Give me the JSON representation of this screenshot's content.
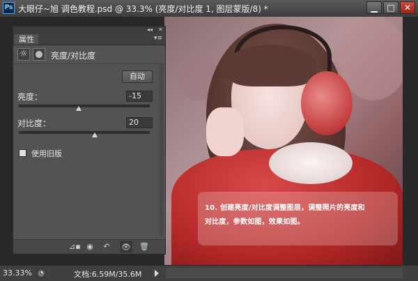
{
  "window": {
    "app_icon": "Ps",
    "title": "大眼仔~旭 调色教程.psd @ 33.3% (亮度/对比度 1, 图层蒙版/8) *",
    "buttons": [
      "minimize-icon",
      "maximize-icon",
      "close-icon"
    ]
  },
  "panel": {
    "tab_label": "属性",
    "adjustment_title": "亮度/对比度",
    "auto_label": "自动",
    "brightness": {
      "label": "亮度：",
      "value": "-15",
      "level": 0.46
    },
    "contrast": {
      "label": "对比度：",
      "value": "20",
      "level": 0.58
    },
    "legacy_label": "使用旧版",
    "footer_icons": [
      "clip-icon",
      "view-previous-icon",
      "reset-icon",
      "visibility-icon",
      "delete-icon"
    ]
  },
  "caption": {
    "line1": "10. 创建亮度/对比度调整图层，调整照片的亮度和",
    "line2": "对比度，参数如图，效果如图。"
  },
  "status": {
    "zoom": "33.33%",
    "doc": "文档:6.59M/35.6M"
  },
  "colors": {
    "accent_close": "#c23a2a",
    "coat_red": "#b32828"
  }
}
